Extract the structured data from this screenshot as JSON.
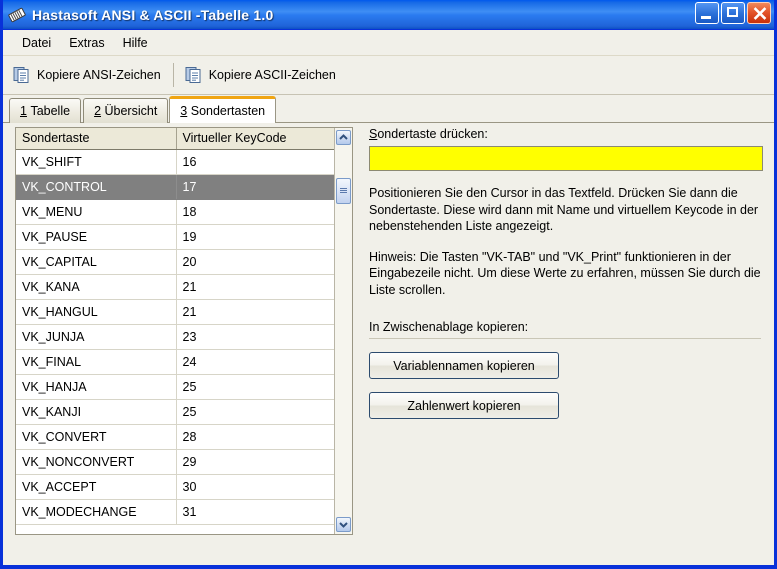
{
  "window": {
    "title": "Hastasoft ANSI & ASCII -Tabelle 1.0",
    "icon": "app-tag-icon",
    "buttons": {
      "minimize": "Minimieren",
      "maximize": "Maximieren",
      "close": "Schließen"
    },
    "accent_titlebar": "#0058ee",
    "frame_color": "#0831d9",
    "face_color": "#f1f0e9"
  },
  "menubar": {
    "items": [
      "Datei",
      "Extras",
      "Hilfe"
    ]
  },
  "toolbar": {
    "buttons": [
      {
        "label": "Kopiere ANSI-Zeichen",
        "icon": "copy-documents-icon"
      },
      {
        "label": "Kopiere ASCII-Zeichen",
        "icon": "copy-documents-icon"
      }
    ]
  },
  "tabs": [
    {
      "mnemonic": "1",
      "label": "Tabelle",
      "active": false
    },
    {
      "mnemonic": "2",
      "label": "Übersicht",
      "active": false
    },
    {
      "mnemonic": "3",
      "label": "Sondertasten",
      "active": true
    }
  ],
  "grid": {
    "columns": [
      "Sondertaste",
      "Virtueller KeyCode"
    ],
    "selected_index": 1,
    "rows": [
      [
        "VK_SHIFT",
        "16"
      ],
      [
        "VK_CONTROL",
        "17"
      ],
      [
        "VK_MENU",
        "18"
      ],
      [
        "VK_PAUSE",
        "19"
      ],
      [
        "VK_CAPITAL",
        "20"
      ],
      [
        "VK_KANA",
        "21"
      ],
      [
        "VK_HANGUL",
        "21"
      ],
      [
        "VK_JUNJA",
        "23"
      ],
      [
        "VK_FINAL",
        "24"
      ],
      [
        "VK_HANJA",
        "25"
      ],
      [
        "VK_KANJI",
        "25"
      ],
      [
        "VK_CONVERT",
        "28"
      ],
      [
        "VK_NONCONVERT",
        "29"
      ],
      [
        "VK_ACCEPT",
        "30"
      ],
      [
        "VK_MODECHANGE",
        "31"
      ]
    ],
    "scrollbar": {
      "up_icon": "chevron-up-icon",
      "down_icon": "chevron-down-icon",
      "thumb": "scrollbar-thumb"
    }
  },
  "panel": {
    "input_label_mnemonic": "S",
    "input_label_rest": "ondertaste drücken:",
    "input_value": "",
    "input_placeholder": "",
    "input_color": "#ffff00",
    "paragraph1": "Positionieren Sie den Cursor in das Textfeld. Drücken Sie dann die Sondertaste. Diese wird dann mit Name und virtuellem Keycode in der nebenstehenden Liste angezeigt.",
    "paragraph2": "Hinweis: Die Tasten \"VK-TAB\" und \"VK_Print\" funktionieren in der Eingabezeile nicht. Um diese Werte zu erfahren, müssen Sie durch die Liste scrollen.",
    "clipboard_label": "In Zwischenablage kopieren:",
    "copy_name_button": "Variablennamen kopieren",
    "copy_value_button": "Zahlenwert kopieren"
  }
}
